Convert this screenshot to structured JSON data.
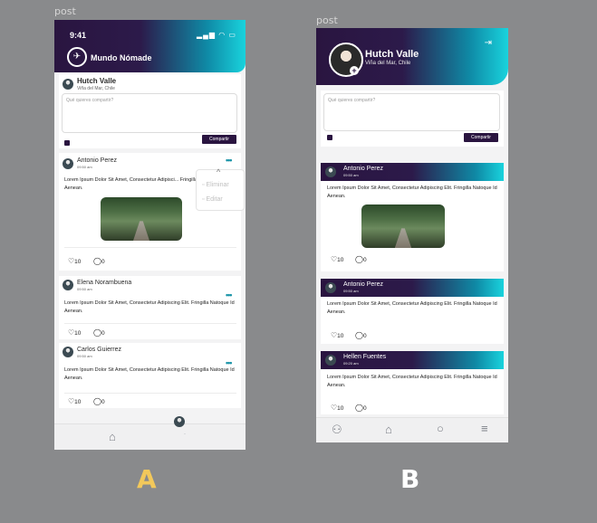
{
  "frame_labels": [
    "post",
    "post"
  ],
  "variantA": {
    "status_time": "9:41",
    "status_icons": "▂▄▆ ◠ ▭",
    "app_name": "Mundo Nómade",
    "compose": {
      "user": "Hutch Valle",
      "location": "Viña del Mar, Chile",
      "placeholder": "Qué quieres compartir?",
      "share_label": "Compartir"
    },
    "posts": [
      {
        "author": "Antonio Perez",
        "time": "09:50 am",
        "text": "Lorem Ipsum Dolor Sit Amet, Consectetur Adipisci... Fringilla Natoque Id Aenean.",
        "likes": "10",
        "comments": "0"
      },
      {
        "author": "Elena Norambuena",
        "time": "09:50 am",
        "text": "Lorem Ipsum Dolor Sit Amet, Consectetur Adipiscing Elit. Fringilla Natoque Id Aenean.",
        "likes": "10",
        "comments": "0"
      },
      {
        "author": "Carlos Guierrez",
        "time": "09:50 am",
        "text": "Lorem Ipsum Dolor Sit Amet, Consectetur Adipiscing Elit. Fringilla Natoque Id Aenean.",
        "likes": "10",
        "comments": "0"
      }
    ],
    "menu": {
      "delete_label": "Eliminar",
      "edit_label": "Editar"
    }
  },
  "variantB": {
    "profile": {
      "name": "Hutch Valle",
      "location": "Viña del Mar, Chile"
    },
    "compose": {
      "placeholder": "Qué quieres compartir?",
      "share_label": "Compartir"
    },
    "posts": [
      {
        "author": "Antonio Perez",
        "time": "09:50 am",
        "text": "Lorem Ipsum Dolor Sit Amet, Consectetur Adipiscing Elit. Fringilla Natoque Id Aenean.",
        "likes": "10",
        "comments": "0"
      },
      {
        "author": "Antonio Perez",
        "time": "09:50 am",
        "text": "Lorem Ipsum Dolor Sit Amet, Consectetur Adipiscing Elit. Fringilla Natoque Id Aenean.",
        "likes": "10",
        "comments": "0"
      },
      {
        "author": "Hellen Fuentes",
        "time": "09:20 am",
        "text": "Lorem Ipsum Dolor Sit Amet, Consectetur Adipiscing Elit. Fringilla Natoque Id Aenean.",
        "likes": "10",
        "comments": "0"
      }
    ]
  },
  "labels": {
    "a": "A",
    "b": "B"
  },
  "colors": {
    "brand_dark": "#2a1540",
    "brand_cyan": "#19d3dd",
    "label_a": "#f2c85b",
    "label_b": "#ffffff"
  },
  "icons": {
    "logo": "plane-logo-icon",
    "image": "image-icon",
    "like": "heart-icon",
    "comment": "comment-icon",
    "more": "more-dots-icon",
    "home": "home-icon",
    "users": "users-icon",
    "chat": "chat-icon",
    "menu": "hamburger-icon",
    "logout": "logout-icon",
    "trash": "trash-icon",
    "edit": "edit-icon",
    "add": "plus-icon"
  }
}
